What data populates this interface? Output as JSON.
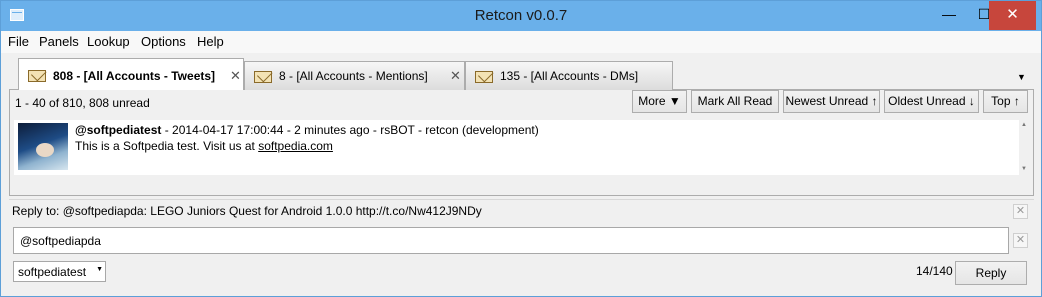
{
  "window": {
    "title": "Retcon v0.0.7",
    "min_glyph": "—",
    "max_glyph": "☐",
    "close_glyph": "✕"
  },
  "menu": [
    "File",
    "Panels",
    "Lookup",
    "Options",
    "Help"
  ],
  "tabs": [
    {
      "label": "808 - [All Accounts - Tweets]",
      "active": true,
      "icon": "envelope-icon"
    },
    {
      "label": "8 - [All Accounts - Mentions]",
      "active": false,
      "icon": "envelope-icon"
    },
    {
      "label": "135 - [All Accounts - DMs]",
      "active": false,
      "icon": "envelope-icon"
    }
  ],
  "tab_close_glyph": "✕",
  "tab_menu_glyph": "▼",
  "panel": {
    "count": "1 - 40 of 810, 808 unread",
    "buttons": {
      "more": "More ▼",
      "mark_all_read": "Mark All Read",
      "newest_unread": "Newest Unread ↑",
      "oldest_unread": "Oldest Unread ↓",
      "top": "Top ↑"
    }
  },
  "tweet": {
    "user": "@softpediatest",
    "meta": " - 2014-04-17 17:00:44 - 2 minutes ago - rsBOT - retcon (development)",
    "text": "This is a Softpedia test. Visit us at ",
    "link": "softpedia.com"
  },
  "reply": {
    "reply_to": "Reply to: @softpediapda: LEGO Juniors Quest for Android 1.0.0 http://t.co/Nw412J9NDy",
    "input_value": "@softpediapda",
    "account": "softpediatest",
    "char_count": "14/140",
    "reply_button": "Reply",
    "clear_glyph": "✕"
  },
  "colors": {
    "titlebar": "#6ab0ea",
    "close_button": "#c7463c"
  }
}
